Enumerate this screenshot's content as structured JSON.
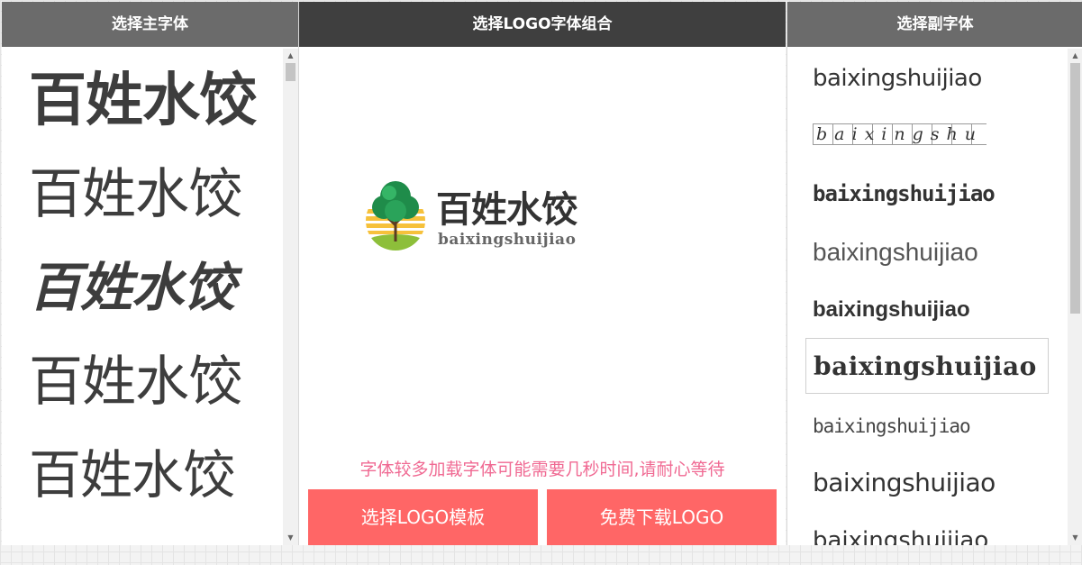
{
  "headers": {
    "main_font": "选择主字体",
    "combo": "选择LOGO字体组合",
    "sub_font": "选择副字体"
  },
  "main_fonts": [
    "百姓水饺",
    "百姓水饺",
    "百姓水饺",
    "百姓水饺",
    "百姓水饺"
  ],
  "preview": {
    "main_text": "百姓水饺",
    "sub_text": "baixingshuijiao",
    "icon": "tree-logo-icon"
  },
  "loading_note": "字体较多加载字体可能需要几秒时间,请耐心等待",
  "buttons": {
    "template": "选择LOGO模板",
    "download": "免费下载LOGO"
  },
  "sub_fonts": [
    "baixingshuijiao",
    "baixingshu",
    "baixingshuijiao",
    "baixingshuijiao",
    "baixingshuijiao",
    "baixingshuijiao",
    "baixingshuijiao",
    "baixingshuijiao",
    "baixingshuijiao"
  ],
  "colors": {
    "button_bg": "#ff6666",
    "note_text": "#f06a93",
    "header_dark": "#3f3f3f",
    "header_gray": "#6b6b6b"
  }
}
